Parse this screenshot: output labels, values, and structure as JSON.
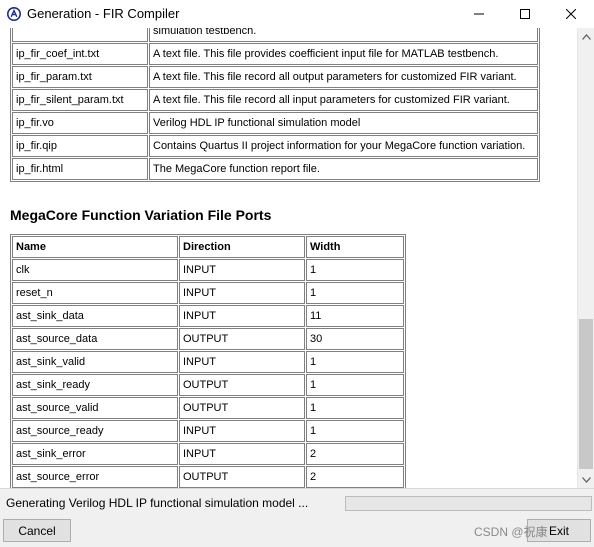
{
  "window": {
    "title": "Generation - FIR Compiler"
  },
  "icons": {
    "app": "app-logo-icon",
    "minimize": "minimize-icon",
    "maximize": "maximize-icon",
    "close": "close-icon",
    "scroll_up": "scroll-up-arrow-icon",
    "scroll_down": "scroll-down-arrow-icon"
  },
  "colors": {
    "progress": "#06b025",
    "table_border": "#808080"
  },
  "files": [
    {
      "name": "",
      "desc": "simulation testbench."
    },
    {
      "name": "ip_fir_coef_int.txt",
      "desc": "A text file. This file provides coefficient input file for MATLAB testbench."
    },
    {
      "name": "ip_fir_param.txt",
      "desc": "A text file. This file record all output parameters for customized FIR variant."
    },
    {
      "name": "ip_fir_silent_param.txt",
      "desc": "A text file. This file record all input parameters for customized FIR variant."
    },
    {
      "name": "ip_fir.vo",
      "desc": "Verilog HDL IP functional simulation model"
    },
    {
      "name": "ip_fir.qip",
      "desc": "Contains Quartus II project information for your MegaCore function variation."
    },
    {
      "name": "ip_fir.html",
      "desc": "The MegaCore function report file."
    }
  ],
  "ports_section": {
    "title": "MegaCore Function Variation File Ports",
    "headers": [
      "Name",
      "Direction",
      "Width"
    ],
    "rows": [
      [
        "clk",
        "INPUT",
        "1"
      ],
      [
        "reset_n",
        "INPUT",
        "1"
      ],
      [
        "ast_sink_data",
        "INPUT",
        "11"
      ],
      [
        "ast_source_data",
        "OUTPUT",
        "30"
      ],
      [
        "ast_sink_valid",
        "INPUT",
        "1"
      ],
      [
        "ast_sink_ready",
        "OUTPUT",
        "1"
      ],
      [
        "ast_source_valid",
        "OUTPUT",
        "1"
      ],
      [
        "ast_source_ready",
        "INPUT",
        "1"
      ],
      [
        "ast_sink_error",
        "INPUT",
        "2"
      ],
      [
        "ast_source_error",
        "OUTPUT",
        "2"
      ]
    ]
  },
  "status": {
    "text": "Generating Verilog HDL IP functional simulation model ...",
    "progress": 0
  },
  "buttons": {
    "cancel": "Cancel",
    "exit": "Exit"
  },
  "watermark": "CSDN @祝康"
}
